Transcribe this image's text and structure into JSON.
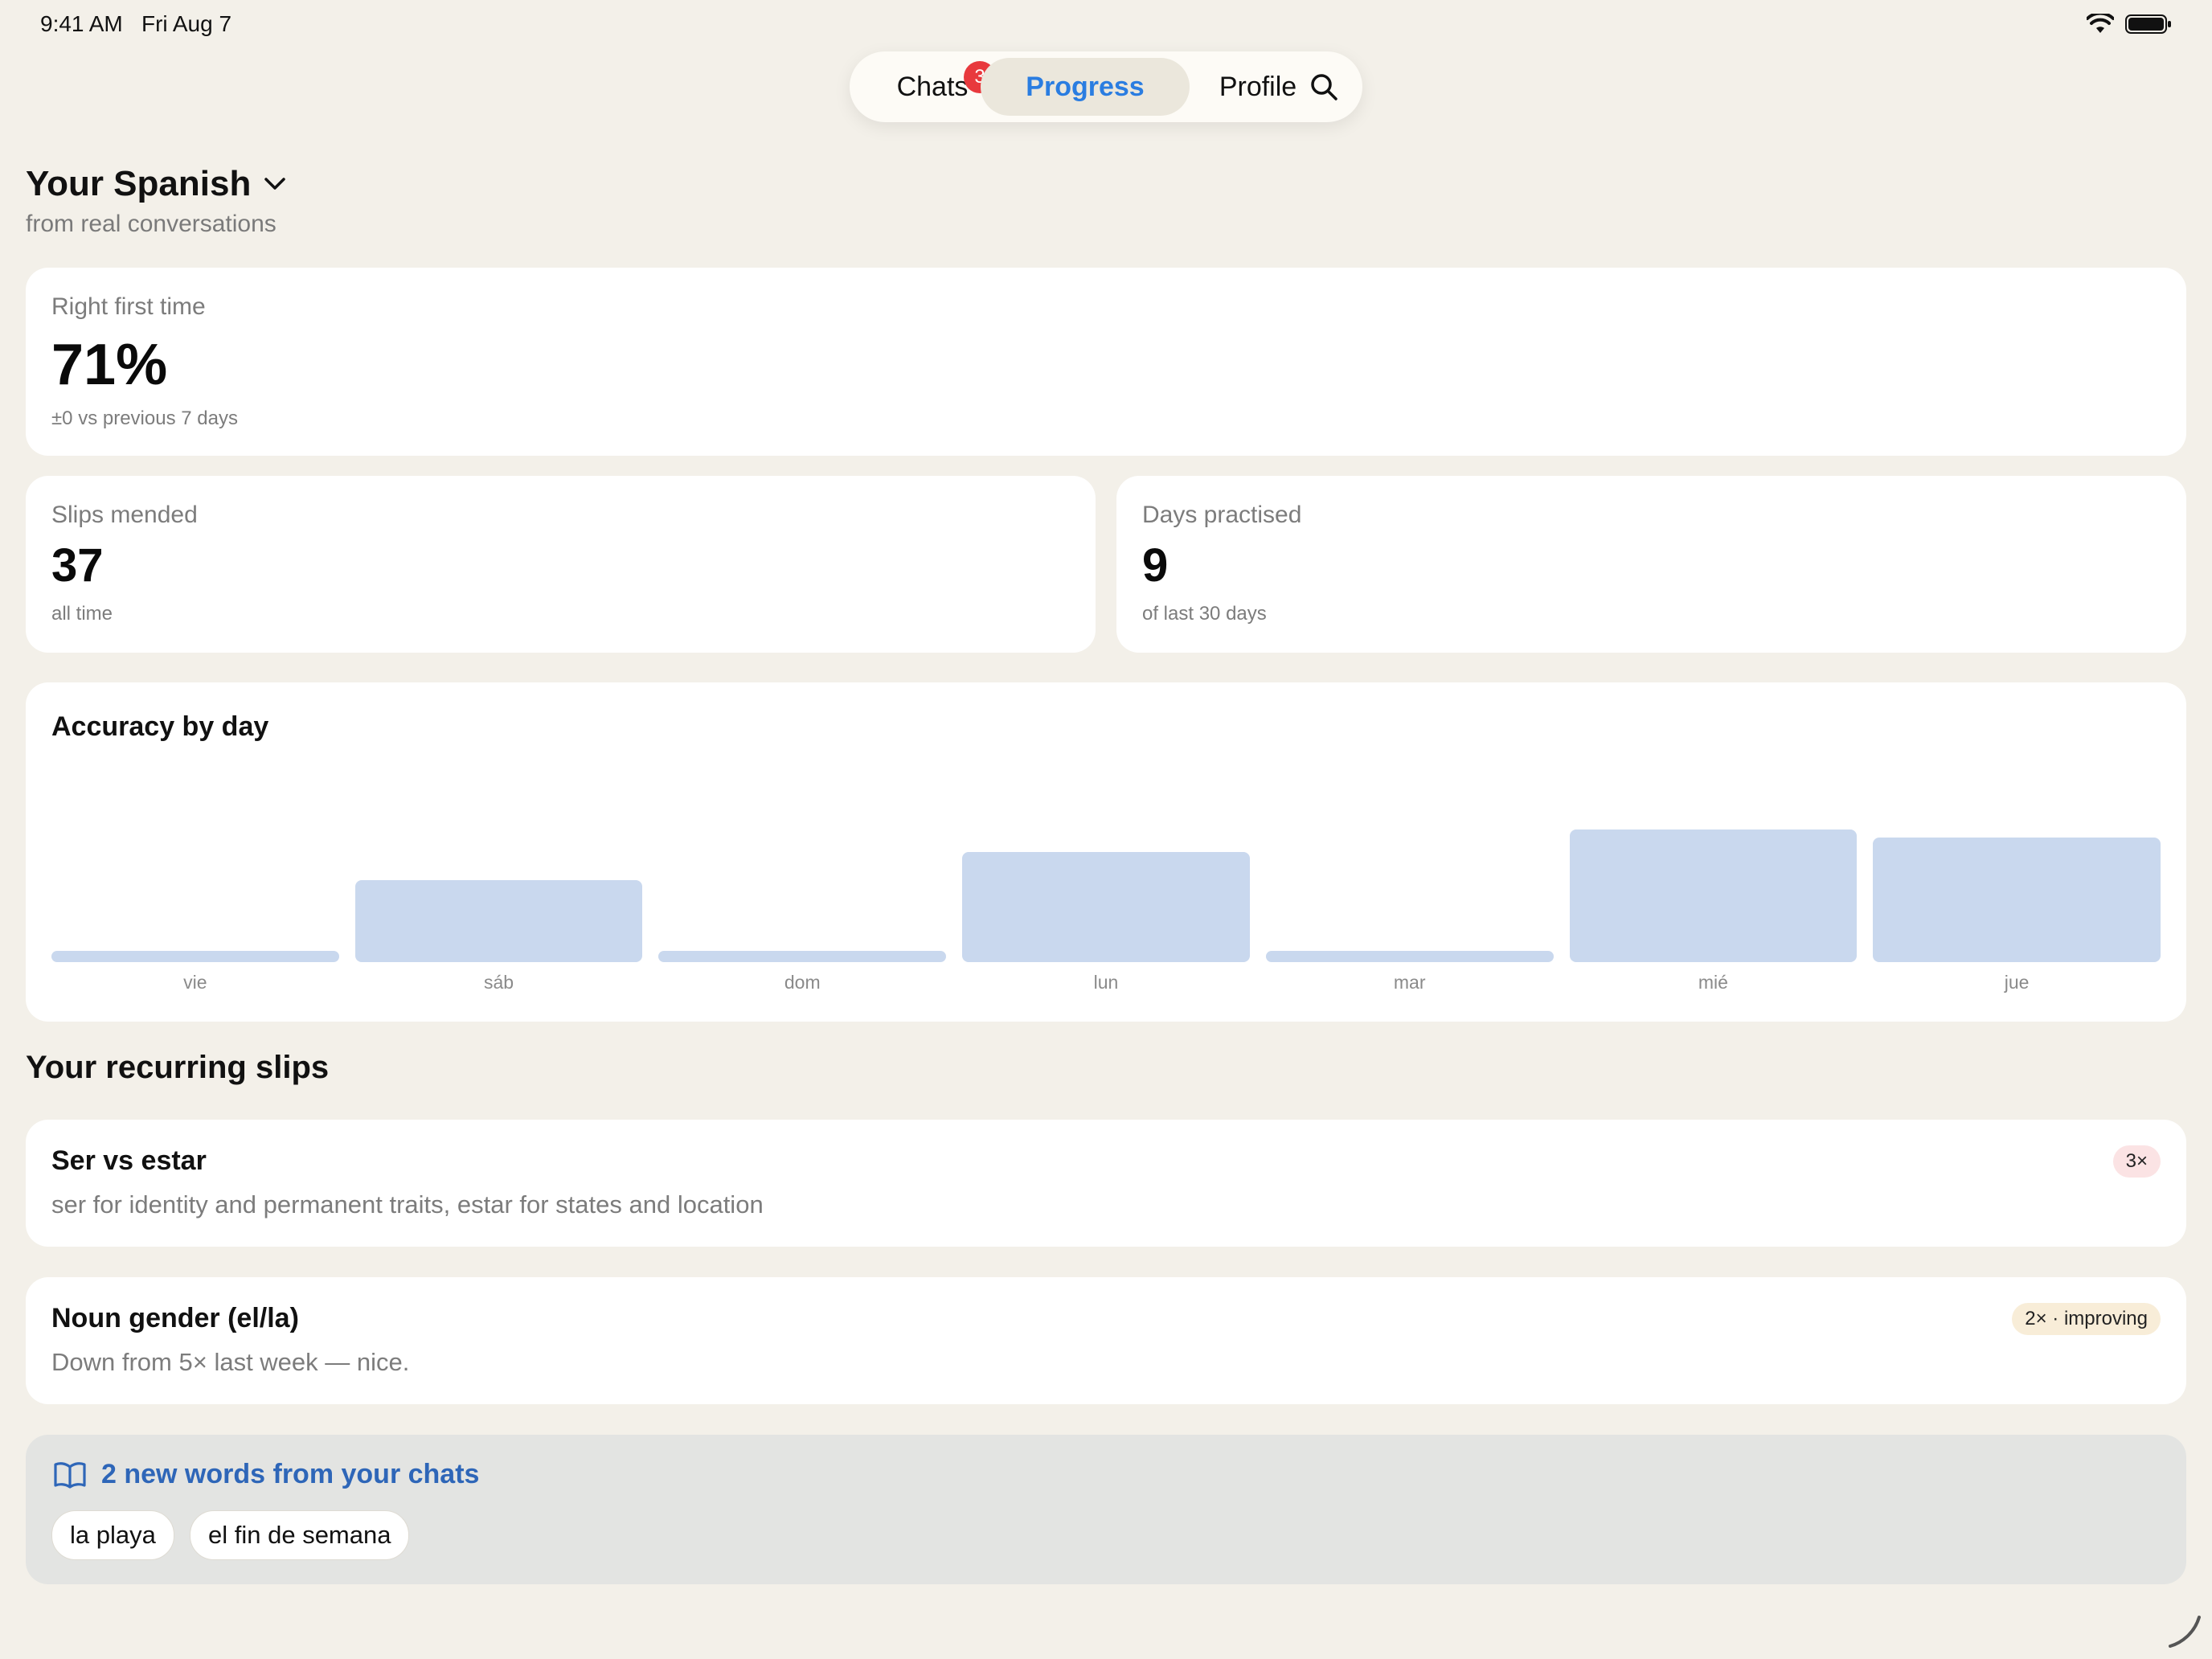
{
  "status_bar": {
    "time": "9:41 AM",
    "date": "Fri Aug 7"
  },
  "nav": {
    "tabs": [
      {
        "label": "Chats",
        "badge": "3"
      },
      {
        "label": "Progress",
        "selected": true
      },
      {
        "label": "Profile"
      }
    ],
    "search_icon": "search-icon"
  },
  "header": {
    "title": "Your Spanish",
    "subtitle": "from real conversations"
  },
  "stats": {
    "right_first_time": {
      "label": "Right first time",
      "value": "71%",
      "note": "±0 vs previous 7 days"
    },
    "slips_mended": {
      "label": "Slips mended",
      "value": "37",
      "note": "all time"
    },
    "days_practised": {
      "label": "Days practised",
      "value": "9",
      "note": "of last 30 days"
    }
  },
  "chart_data": {
    "type": "bar",
    "title": "Accuracy by day",
    "categories": [
      "vie",
      "sáb",
      "dom",
      "lun",
      "mar",
      "mié",
      "jue"
    ],
    "values": [
      0,
      0.58,
      0,
      0.78,
      0,
      0.94,
      0.88
    ],
    "ylim": [
      0,
      1
    ],
    "grid": false
  },
  "slips": {
    "section_title": "Your recurring slips",
    "items": [
      {
        "title": "Ser vs estar",
        "description": "ser for identity and permanent traits, estar for states and location",
        "badge": "3×",
        "badge_color": "#fbe3e4"
      },
      {
        "title": "Noun gender (el/la)",
        "description": "Down from 5× last week — nice.",
        "badge": "2× · improving",
        "badge_color": "#f8edd8"
      }
    ]
  },
  "new_words": {
    "heading": "2 new words from your chats",
    "icon": "book-icon",
    "words": [
      "la playa",
      "el fin de semana"
    ]
  },
  "colors": {
    "accent": "#2a7de1",
    "bar": "#c9d8ee",
    "background": "#f3f0e9"
  }
}
